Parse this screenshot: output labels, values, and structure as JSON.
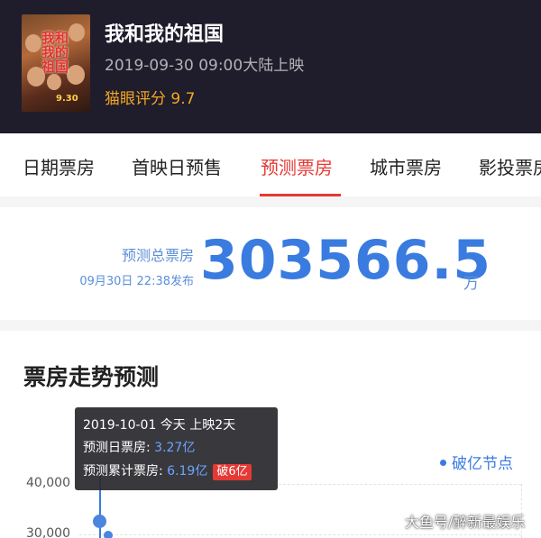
{
  "movie": {
    "title": "我和我的祖国",
    "release": "2019-09-30 09:00大陆上映",
    "rating": "猫眼评分 9.7",
    "poster": {
      "title_text": "我和我的祖国",
      "date_text": "9.30"
    }
  },
  "tabs": [
    {
      "label": "日期票房",
      "active": false
    },
    {
      "label": "首映日预售",
      "active": false
    },
    {
      "label": "预测票房",
      "active": true
    },
    {
      "label": "城市票房",
      "active": false
    },
    {
      "label": "影投票房",
      "active": false
    }
  ],
  "summary": {
    "label": "预测总票房",
    "published": "09月30日 22:38发布",
    "value": "303566.5",
    "unit": "万"
  },
  "trend": {
    "title": "票房走势预测",
    "legend": "破亿节点",
    "y_ticks": [
      "40,000",
      "30,000"
    ],
    "tooltip": {
      "date_line": "2019-10-01 今天 上映2天",
      "daily_label": "预测日票房:",
      "daily_value": "3.27亿",
      "cumulative_label": "预测累计票房:",
      "cumulative_value": "6.19亿",
      "badge": "破6亿"
    }
  },
  "chart_data": {
    "type": "line",
    "title": "票房走势预测",
    "ylim": [
      30000,
      40000
    ],
    "y_ticks": [
      40000,
      30000
    ],
    "legend": [
      "破亿节点"
    ],
    "series": [
      {
        "name": "破亿节点",
        "x": [
          "2019-10-01"
        ],
        "values": [
          32700
        ]
      }
    ]
  },
  "watermark": "大鱼号/醉新最娱乐",
  "colors": {
    "header_bg": "#1f1d2b",
    "accent_red": "#e53935",
    "accent_blue": "#3a7be0",
    "rating": "#f5a623"
  }
}
